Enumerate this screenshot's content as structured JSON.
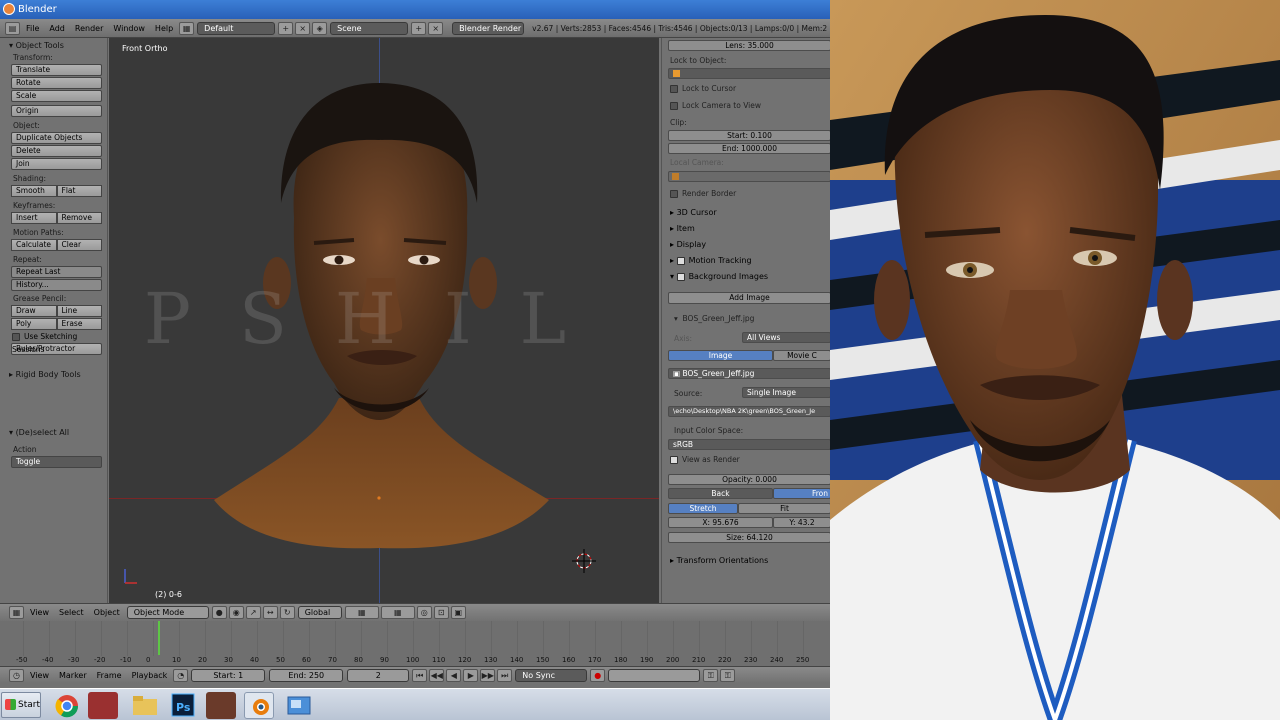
{
  "window": {
    "title": "Blender"
  },
  "topbar": {
    "menus": [
      "File",
      "Add",
      "Render",
      "Window",
      "Help"
    ],
    "layout": "Default",
    "scene": "Scene",
    "engine": "Blender Render",
    "info": "v2.67 | Verts:2853 | Faces:4546 | Tris:4546 | Objects:0/13 | Lamps:0/0 | Mem:2"
  },
  "toolshelf": {
    "header": "Object Tools",
    "transform_label": "Transform:",
    "translate": "Translate",
    "rotate": "Rotate",
    "scale": "Scale",
    "origin": "Origin",
    "object_label": "Object:",
    "duplicate": "Duplicate Objects",
    "delete": "Delete",
    "join": "Join",
    "shading_label": "Shading:",
    "smooth": "Smooth",
    "flat": "Flat",
    "keyframes_label": "Keyframes:",
    "insert": "Insert",
    "remove": "Remove",
    "motion_label": "Motion Paths:",
    "calculate": "Calculate",
    "clear": "Clear",
    "repeat_label": "Repeat:",
    "repeat_last": "Repeat Last",
    "history": "History...",
    "grease_label": "Grease Pencil:",
    "draw": "Draw",
    "line": "Line",
    "poly": "Poly",
    "erase": "Erase",
    "sketching": "Use Sketching Sessions",
    "ruler": "Ruler/Protractor",
    "rigid": "Rigid Body Tools",
    "deselect": "(De)select All",
    "action_label": "Action",
    "action_value": "Toggle"
  },
  "viewport": {
    "view_label": "Front Ortho",
    "object_label": "(2) 0-6",
    "watermark": "PSHIL"
  },
  "props": {
    "lens": "Lens: 35.000",
    "lock_to_object": "Lock to Object:",
    "lock_cursor": "Lock to Cursor",
    "lock_camera": "Lock Camera to View",
    "clip": "Clip:",
    "clip_start": "Start: 0.100",
    "clip_end": "End: 1000.000",
    "local_camera": "Local Camera:",
    "render_border": "Render Border",
    "cursor_3d": "3D Cursor",
    "item": "Item",
    "display": "Display",
    "motion_tracking": "Motion Tracking",
    "bg_images": "Background Images",
    "add_image": "Add Image",
    "bg_file": "BOS_Green_Jeff.jpg",
    "axis_label": "Axis:",
    "axis_value": "All Views",
    "tab_image": "Image",
    "tab_movie": "Movie C",
    "image_name": "BOS_Green_Jeff.jpg",
    "source_label": "Source:",
    "source_value": "Single Image",
    "path": "\\echo\\Desktop\\NBA 2K\\green\\BOS_Green_Je",
    "color_space_label": "Input Color Space:",
    "color_space": "sRGB",
    "view_as_render": "View as Render",
    "opacity": "Opacity: 0.000",
    "back": "Back",
    "front": "Fron",
    "stretch": "Stretch",
    "fit": "Fit",
    "x": "X: 95.676",
    "y": "Y: 43.2",
    "size": "Size: 64.120",
    "transform_orient": "Transform Orientations"
  },
  "vpheader": {
    "view": "View",
    "select": "Select",
    "object": "Object",
    "mode": "Object Mode",
    "orientation": "Global"
  },
  "timeline": {
    "ticks": [
      "-50",
      "-40",
      "-30",
      "-20",
      "-10",
      "0",
      "10",
      "20",
      "30",
      "40",
      "50",
      "60",
      "70",
      "80",
      "90",
      "100",
      "110",
      "120",
      "130",
      "140",
      "150",
      "160",
      "170",
      "180",
      "190",
      "200",
      "210",
      "220",
      "230",
      "240",
      "250"
    ]
  },
  "tlheader": {
    "view": "View",
    "marker": "Marker",
    "frame": "Frame",
    "playback": "Playback",
    "start": "Start: 1",
    "end": "End: 250",
    "current": "2",
    "sync": "No Sync"
  },
  "taskbar": {
    "start": "Start"
  },
  "colors": {
    "accent": "#5680c2",
    "skin": "#6b4326",
    "jersey": "#f2f2f2",
    "court_blue": "#1e3f8c"
  }
}
